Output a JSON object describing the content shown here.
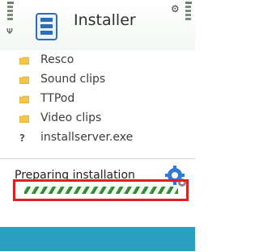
{
  "header": {
    "title": "Installer",
    "app_icon": "installer-app-icon",
    "options_icon": "options-icon",
    "signal_icon": "antenna-icon"
  },
  "list": {
    "items": [
      {
        "label": "Resco",
        "icon": "folder-icon"
      },
      {
        "label": "Sound clips",
        "icon": "folder-icon"
      },
      {
        "label": "TTPod",
        "icon": "folder-icon"
      },
      {
        "label": "Video clips",
        "icon": "folder-icon"
      },
      {
        "label": "installserver.exe",
        "icon": "unknown-file-icon"
      }
    ]
  },
  "dialog": {
    "message": "Preparing installation",
    "icon": "settings-gear-icon"
  },
  "colors": {
    "accent": "#2aa0c0",
    "progress": "#3ea03e",
    "highlight": "#e02020"
  }
}
